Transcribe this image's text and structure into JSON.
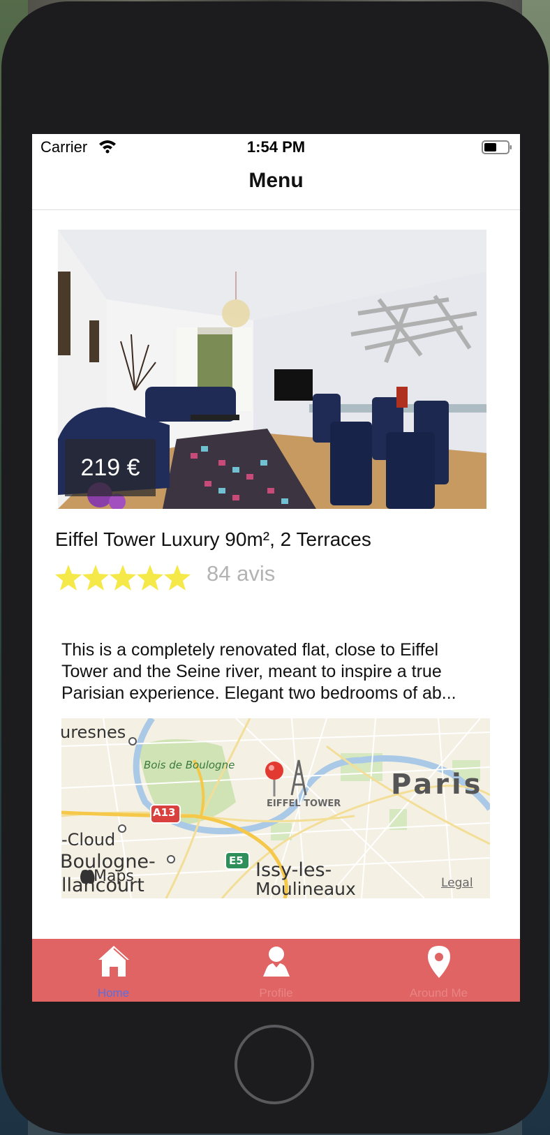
{
  "status_bar": {
    "carrier": "Carrier",
    "time": "1:54 PM"
  },
  "nav": {
    "title": "Menu"
  },
  "listing": {
    "price": "219 €",
    "title": "Eiffel Tower Luxury 90m², 2 Terraces",
    "rating_stars": 5,
    "rating_max": 5,
    "reviews": "84 avis",
    "description": "This is a completely renovated flat, close to Eiffel Tower and the Seine river, meant to inspire a true Parisian experience. Elegant two bedrooms of ab..."
  },
  "map": {
    "labels": {
      "suresnes": "uresnes",
      "bois": "Bois de Boulogne",
      "paris": "Paris",
      "eiffel": "EIFFEL TOWER",
      "a13": "A13",
      "e5": "E5",
      "cloud": "-Cloud",
      "boulogne": "Boulogne-",
      "billancourt": "llancourt",
      "issy1": "Issy-les-",
      "issy2": "Moulineaux",
      "maps": "Maps",
      "legal": "Legal"
    }
  },
  "tabs": [
    {
      "label": "Home",
      "icon": "home-icon",
      "active": true
    },
    {
      "label": "Profile",
      "icon": "person-icon",
      "active": false
    },
    {
      "label": "Around Me",
      "icon": "location-pin-icon",
      "active": false
    }
  ],
  "colors": {
    "tab_bar": "#e06464",
    "active_tab": "#5a6ee0",
    "inactive_tab": "#e98585",
    "star": "#f5e94a",
    "review_text": "#b3b3b3"
  }
}
